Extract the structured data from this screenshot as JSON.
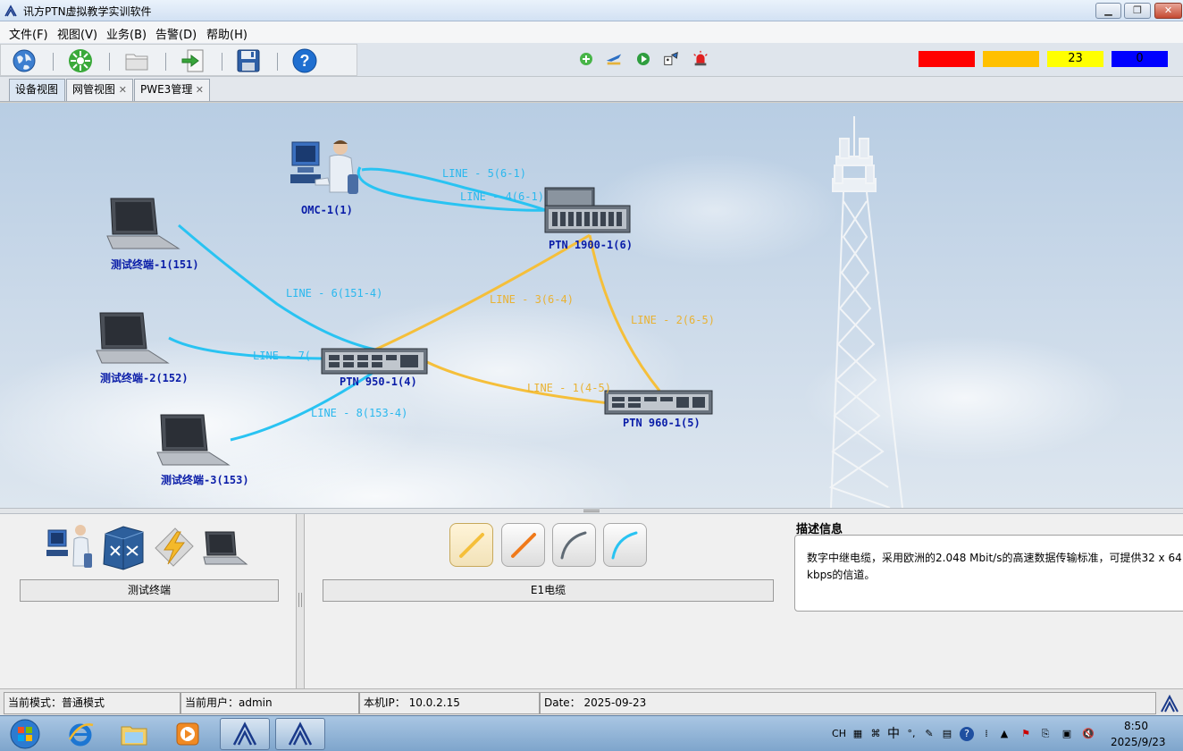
{
  "window": {
    "title": "讯方PTN虚拟教学实训软件"
  },
  "menu": [
    "文件(F)",
    "视图(V)",
    "业务(B)",
    "告警(D)",
    "帮助(H)"
  ],
  "toolbar": {
    "main_icons": [
      "globe-icon",
      "network-node-icon",
      "open-folder-icon",
      "export-icon",
      "save-icon",
      "help-icon"
    ],
    "small_icons": [
      "add-icon",
      "airplane-config-icon",
      "play-icon",
      "robot-config-icon",
      "alarm-light-icon"
    ]
  },
  "alarms": {
    "critical": {
      "color": "#ff0000",
      "value": ""
    },
    "major": {
      "color": "#ffc000",
      "value": ""
    },
    "minor": {
      "color": "#ffff00",
      "value": "23"
    },
    "warning": {
      "color": "#0000ff",
      "value": "0"
    }
  },
  "tabs": [
    {
      "label": "设备视图",
      "active": true,
      "closable": false
    },
    {
      "label": "网管视图",
      "active": false,
      "closable": true
    },
    {
      "label": "PWE3管理",
      "active": false,
      "closable": true
    }
  ],
  "topology": {
    "nodes": {
      "omc": "OMC-1(1)",
      "ptn1900": "PTN 1900-1(6)",
      "term1": "测试终端-1(151)",
      "term2": "测试终端-2(152)",
      "term3": "测试终端-3(153)",
      "ptn950": "PTN 950-1(4)",
      "ptn960": "PTN 960-1(5)"
    },
    "links": {
      "line5": "LINE - 5(6-1)",
      "line4": "LINE - 4(6-1)",
      "line6": "LINE - 6(151-4)",
      "line3": "LINE - 3(6-4)",
      "line2": "LINE - 2(6-5)",
      "line7": "LINE - 7(",
      "line1": "LINE - 1(4-5)",
      "line8": "LINE - 8(153-4)"
    },
    "colors": {
      "fiber": "#29c3f2",
      "e1": "#f5bf3a",
      "label_fiber": "#2ab8ee",
      "label_e1": "#e9b233"
    }
  },
  "palette": {
    "device_icons": [
      "omc-operator-icon",
      "router-icon",
      "lightning-icon",
      "laptop-icon"
    ],
    "device_label": "测试终端",
    "cable_icons": [
      "yellow-cable-icon",
      "orange-cable-icon",
      "gray-cable-icon",
      "blue-cable-icon"
    ],
    "cable_label": "E1电缆",
    "description_title": "描述信息",
    "description": "数字中继电缆，采用欧洲的2.048 Mbit/s的高速数据传输标准，可提供32 x 64 kbps的信道。"
  },
  "status": {
    "mode": "当前模式：普通模式",
    "user": "当前用户：admin",
    "ip": "本机IP：  10.0.2.15",
    "date": "Date：  2025-09-23"
  },
  "taskbar": {
    "apps": [
      "start-orb-icon",
      "ie-icon",
      "explorer-icon",
      "media-player-icon",
      "xunfang-app-icon",
      "xunfang-app-icon"
    ],
    "tray_text": [
      "CH",
      "中",
      "°,"
    ],
    "time": "8:50",
    "date": "2025/9/23"
  }
}
